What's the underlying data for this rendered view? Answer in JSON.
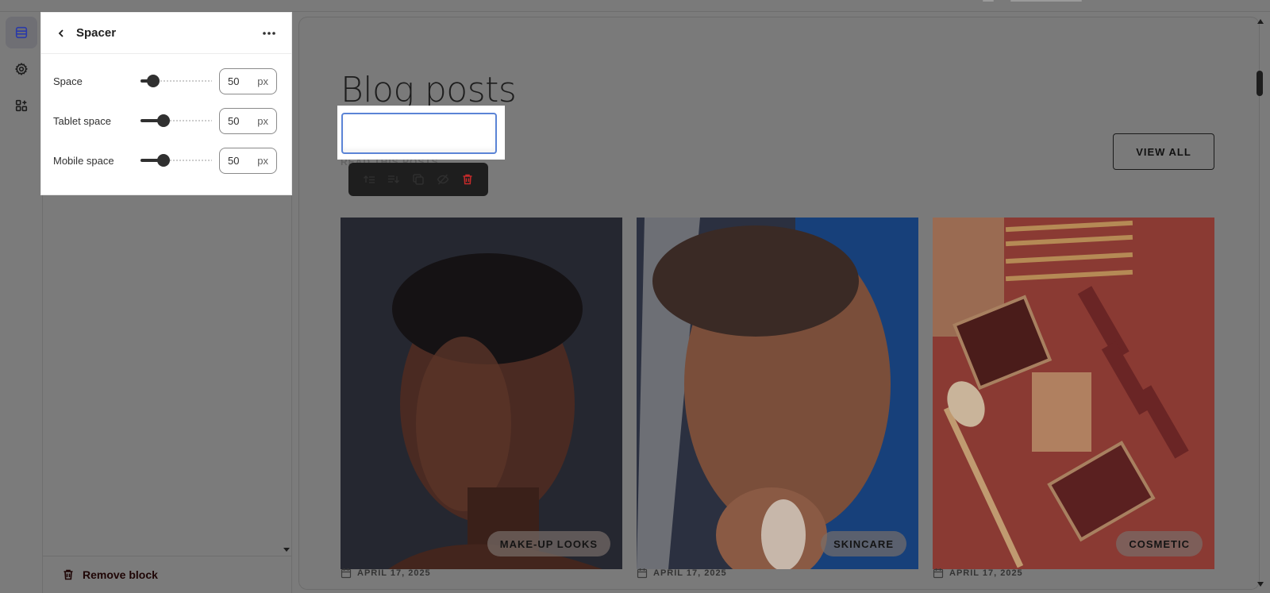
{
  "sidebar": {
    "panel_title": "Spacer",
    "rows": [
      {
        "label": "Space",
        "value": "50",
        "unit": "px",
        "level": 0.18
      },
      {
        "label": "Tablet space",
        "value": "50",
        "unit": "px",
        "level": 0.32
      },
      {
        "label": "Mobile space",
        "value": "50",
        "unit": "px",
        "level": 0.32
      }
    ],
    "remove_label": "Remove block"
  },
  "rail": {
    "icons": [
      "sections-icon",
      "settings-gear-icon",
      "apps-icon"
    ],
    "active": 0
  },
  "preview": {
    "heading": "Blog posts",
    "subtitle": "READ THIS POSTS",
    "view_all": "VIEW ALL",
    "cards": [
      {
        "tag": "MAKE-UP LOOKS",
        "date": "APRIL 17, 2025"
      },
      {
        "tag": "SKINCARE",
        "date": "APRIL 17, 2025"
      },
      {
        "tag": "COSMETIC",
        "date": "APRIL 17, 2025"
      }
    ]
  },
  "colors": {
    "overlay": "#7b7b7b",
    "accent_blue": "#5b84d6",
    "toolbar_bg": "#1e1e1e",
    "delete_red": "#e03030"
  }
}
